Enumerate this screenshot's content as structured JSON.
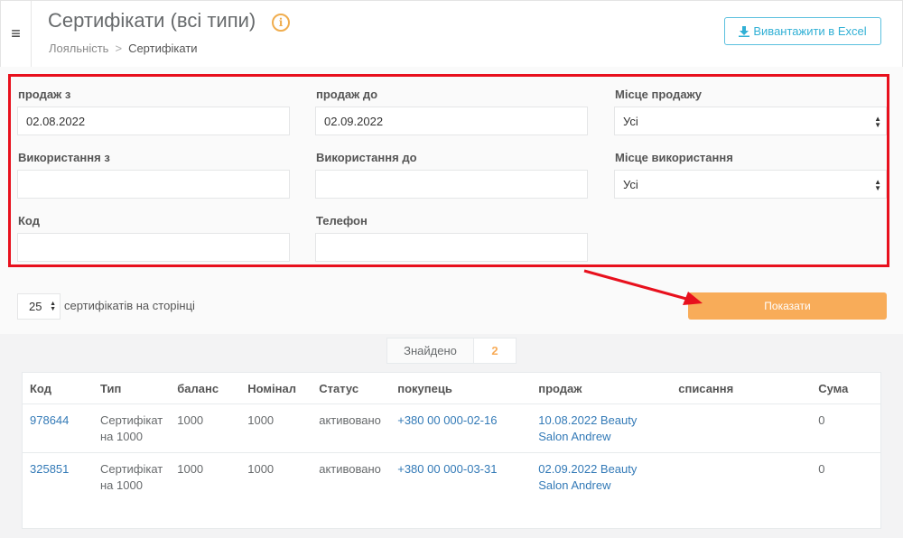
{
  "header": {
    "title": "Сертифікати (всі типи)",
    "breadcrumb": {
      "parent": "Лояльність",
      "separator": ">",
      "current": "Сертифікати"
    },
    "export_label": "Вивантажити в Excel"
  },
  "filters": {
    "sale_from": {
      "label": "продаж з",
      "value": "02.08.2022"
    },
    "sale_to": {
      "label": "продаж до",
      "value": "02.09.2022"
    },
    "sale_place": {
      "label": "Місце продажу",
      "value": "Усі"
    },
    "use_from": {
      "label": "Використання з",
      "value": ""
    },
    "use_to": {
      "label": "Використання до",
      "value": ""
    },
    "use_place": {
      "label": "Місце використання",
      "value": "Усі"
    },
    "code": {
      "label": "Код",
      "value": ""
    },
    "phone": {
      "label": "Телефон",
      "value": ""
    }
  },
  "per_page": {
    "value": "25",
    "label": "сертифікатів на сторінці"
  },
  "show_label": "Показати",
  "found": {
    "label": "Знайдено",
    "count": "2"
  },
  "table": {
    "columns": [
      "Код",
      "Тип",
      "баланс",
      "Номінал",
      "Статус",
      "покупець",
      "продаж",
      "списання",
      "Сума"
    ],
    "rows": [
      {
        "code": "978644",
        "type": "Сертифікат на 1000",
        "balance": "1000",
        "nominal": "1000",
        "status": "активовано",
        "buyer": "+380 00 000-02-16",
        "sale": "10.08.2022 Beauty Salon Andrew",
        "writeoff": "",
        "sum": "0"
      },
      {
        "code": "325851",
        "type": "Сертифікат на 1000",
        "balance": "1000",
        "nominal": "1000",
        "status": "активовано",
        "buyer": "+380 00 000-03-31",
        "sale": "02.09.2022 Beauty Salon Andrew",
        "writeoff": "",
        "sum": "0"
      }
    ]
  },
  "colors": {
    "highlight": "#e8101d",
    "show_button": "#f8ac59",
    "export_border": "#5bc0de",
    "link": "#337ab7"
  }
}
